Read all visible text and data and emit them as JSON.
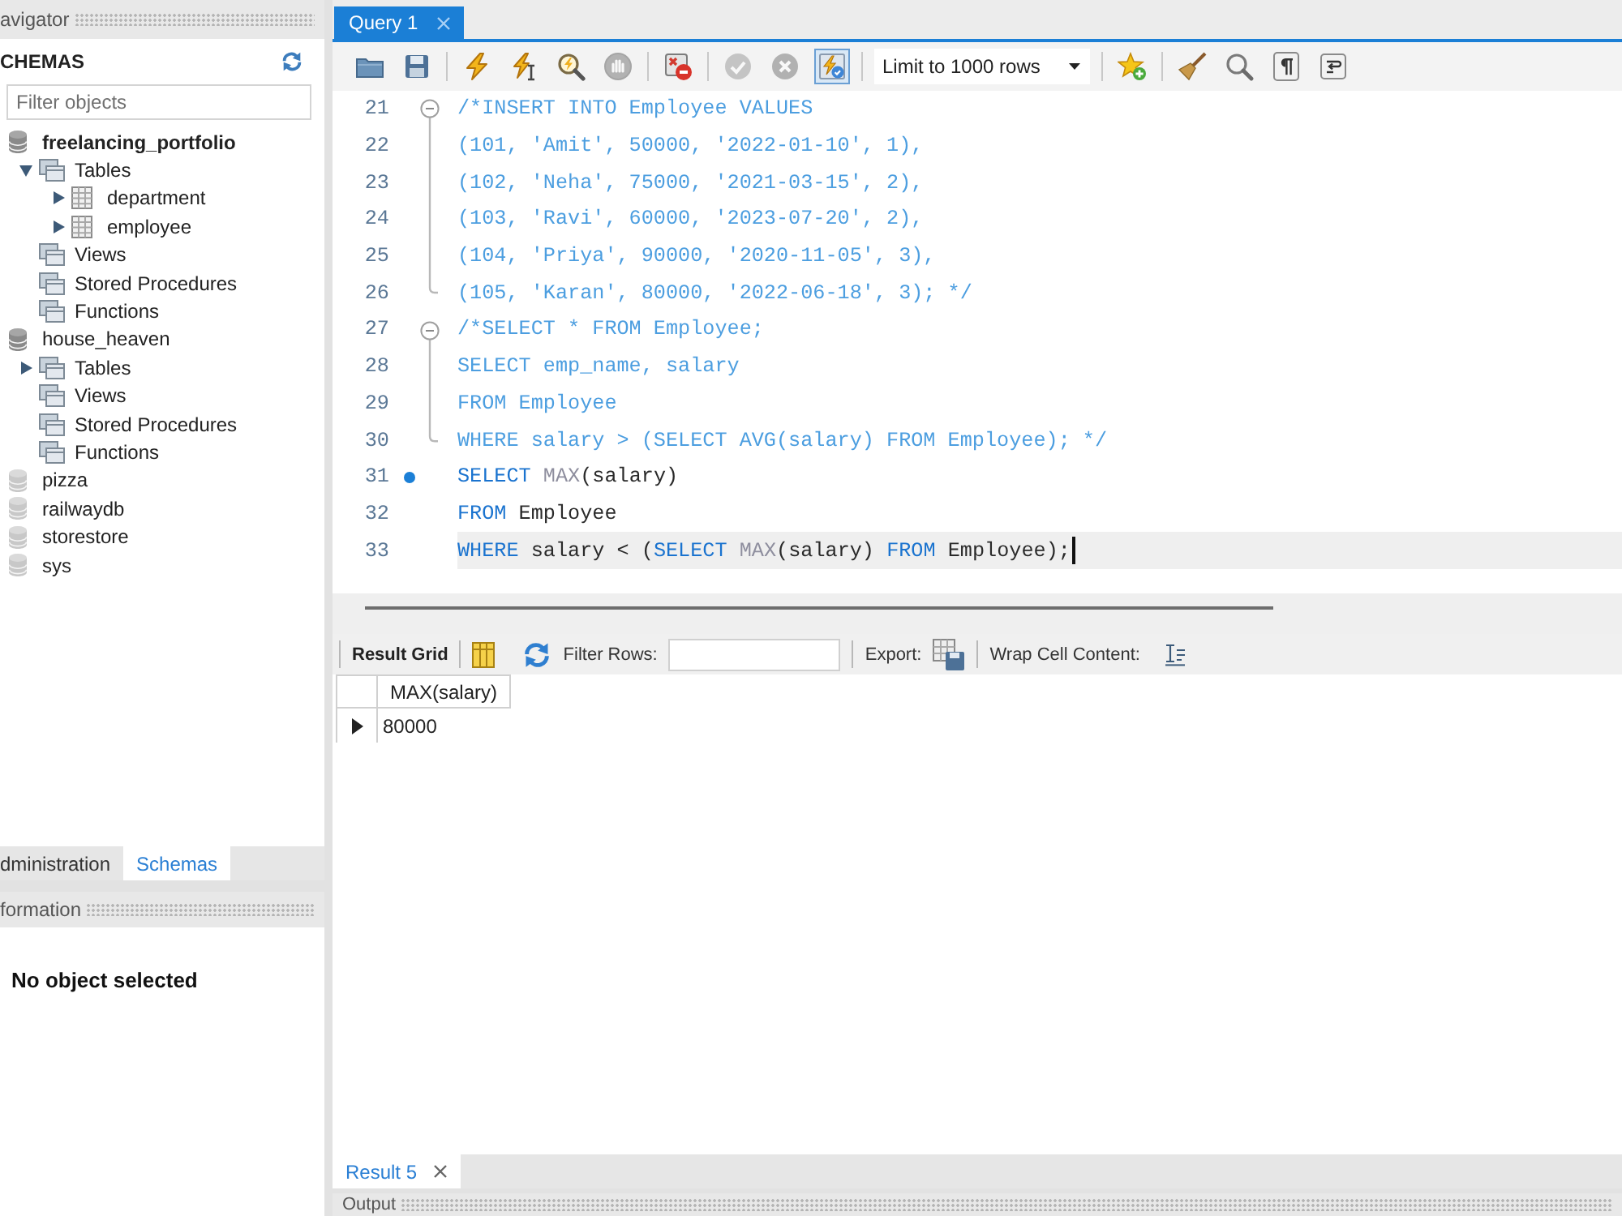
{
  "navigator": {
    "header": "avigator",
    "schemas_title": "CHEMAS",
    "filter": {
      "placeholder": "Filter objects"
    },
    "schemas": [
      {
        "kind": "schema",
        "name": "freelancing_portfolio",
        "default": true,
        "expanded": true,
        "children": [
          {
            "kind": "folder",
            "name": "Tables",
            "expanded": true,
            "children": [
              {
                "kind": "table",
                "name": "department",
                "expanded": false
              },
              {
                "kind": "table",
                "name": "employee",
                "expanded": false
              }
            ]
          },
          {
            "kind": "folder",
            "name": "Views"
          },
          {
            "kind": "folder",
            "name": "Stored Procedures"
          },
          {
            "kind": "folder",
            "name": "Functions"
          }
        ]
      },
      {
        "kind": "schema",
        "name": "house_heaven",
        "default": false,
        "expanded": true,
        "children": [
          {
            "kind": "folder",
            "name": "Tables",
            "expanded": false
          },
          {
            "kind": "folder",
            "name": "Views"
          },
          {
            "kind": "folder",
            "name": "Stored Procedures"
          },
          {
            "kind": "folder",
            "name": "Functions"
          }
        ]
      },
      {
        "kind": "schema",
        "name": "pizza",
        "default": false,
        "expanded": false
      },
      {
        "kind": "schema",
        "name": "railwaydb",
        "default": false,
        "expanded": false
      },
      {
        "kind": "schema",
        "name": "storestore",
        "default": false,
        "expanded": false
      },
      {
        "kind": "schema",
        "name": "sys",
        "default": false,
        "expanded": false
      }
    ],
    "tabs": [
      {
        "label": "dministration",
        "selected": false
      },
      {
        "label": "Schemas",
        "selected": true
      }
    ]
  },
  "information": {
    "header": "formation",
    "message": "No object selected"
  },
  "editor": {
    "tabs": [
      {
        "label": "Query 1",
        "selected": true
      }
    ],
    "toolbar": {
      "groups": [
        [
          {
            "kind": "open",
            "disabled": false,
            "pressed": false
          },
          {
            "kind": "save",
            "disabled": false,
            "pressed": false
          }
        ],
        [
          {
            "kind": "execute",
            "disabled": false,
            "pressed": false
          },
          {
            "kind": "execute-statement",
            "disabled": false,
            "pressed": false
          },
          {
            "kind": "explain",
            "disabled": false,
            "pressed": false
          },
          {
            "kind": "stop",
            "disabled": true,
            "pressed": false
          }
        ],
        [
          {
            "kind": "stop-on-error",
            "disabled": false,
            "pressed": false
          }
        ],
        [
          {
            "kind": "commit",
            "disabled": true,
            "pressed": false
          },
          {
            "kind": "rollback",
            "disabled": true,
            "pressed": false
          },
          {
            "kind": "autocommit",
            "disabled": false,
            "pressed": true
          }
        ],
        [
          {
            "kind": "dropdown",
            "value": "Limit to 1000 rows"
          }
        ],
        [
          {
            "kind": "bookmark",
            "disabled": false,
            "pressed": false
          }
        ],
        [
          {
            "kind": "beautify",
            "disabled": false,
            "pressed": false
          },
          {
            "kind": "find",
            "disabled": false,
            "pressed": false
          },
          {
            "kind": "invisibles",
            "disabled": false,
            "pressed": false
          },
          {
            "kind": "wrap",
            "disabled": false,
            "pressed": false
          }
        ]
      ]
    },
    "lines": [
      {
        "number": "21",
        "kind": "opener",
        "marker": false,
        "current": false,
        "tokens": [
          {
            "kind": "comment",
            "text": "/*INSERT INTO Employee VALUES"
          }
        ]
      },
      {
        "number": "22",
        "kind": "body",
        "marker": false,
        "current": false,
        "tokens": [
          {
            "kind": "comment",
            "text": "(101, 'Amit', 50000, '2022-01-10', 1),"
          }
        ]
      },
      {
        "number": "23",
        "kind": "body",
        "marker": false,
        "current": false,
        "tokens": [
          {
            "kind": "comment",
            "text": "(102, 'Neha', 75000, '2021-03-15', 2),"
          }
        ]
      },
      {
        "number": "24",
        "kind": "body",
        "marker": false,
        "current": false,
        "tokens": [
          {
            "kind": "comment",
            "text": "(103, 'Ravi', 60000, '2023-07-20', 2),"
          }
        ]
      },
      {
        "number": "25",
        "kind": "body",
        "marker": false,
        "current": false,
        "tokens": [
          {
            "kind": "comment",
            "text": "(104, 'Priya', 90000, '2020-11-05', 3),"
          }
        ]
      },
      {
        "number": "26",
        "kind": "closer",
        "marker": false,
        "current": false,
        "tokens": [
          {
            "kind": "comment",
            "text": "(105, 'Karan', 80000, '2022-06-18', 3); */"
          }
        ]
      },
      {
        "number": "27",
        "kind": "opener",
        "marker": false,
        "current": false,
        "tokens": [
          {
            "kind": "comment",
            "text": "/*SELECT * FROM Employee;"
          }
        ]
      },
      {
        "number": "28",
        "kind": "body",
        "marker": false,
        "current": false,
        "tokens": [
          {
            "kind": "comment",
            "text": "SELECT emp_name, salary"
          }
        ]
      },
      {
        "number": "29",
        "kind": "body",
        "marker": false,
        "current": false,
        "tokens": [
          {
            "kind": "comment",
            "text": "FROM Employee"
          }
        ]
      },
      {
        "number": "30",
        "kind": "closer",
        "marker": false,
        "current": false,
        "tokens": [
          {
            "kind": "comment",
            "text": "WHERE salary > (SELECT AVG(salary) FROM Employee); */"
          }
        ]
      },
      {
        "number": "31",
        "kind": "plain",
        "marker": true,
        "current": false,
        "tokens": [
          {
            "kind": "keyword",
            "text": "SELECT "
          },
          {
            "kind": "function",
            "text": "MAX"
          },
          {
            "kind": "plain",
            "text": "(salary)"
          }
        ]
      },
      {
        "number": "32",
        "kind": "plain",
        "marker": false,
        "current": false,
        "tokens": [
          {
            "kind": "keyword",
            "text": "FROM"
          },
          {
            "kind": "plain",
            "text": " Employee"
          }
        ]
      },
      {
        "number": "33",
        "kind": "plain",
        "marker": false,
        "current": true,
        "tokens": [
          {
            "kind": "keyword",
            "text": "WHERE"
          },
          {
            "kind": "plain",
            "text": " salary < ("
          },
          {
            "kind": "keyword",
            "text": "SELECT "
          },
          {
            "kind": "function",
            "text": "MAX"
          },
          {
            "kind": "plain",
            "text": "(salary) "
          },
          {
            "kind": "keyword",
            "text": "FROM"
          },
          {
            "kind": "plain",
            "text": " Employee);"
          }
        ]
      }
    ]
  },
  "results": {
    "toolbar": {
      "view_label": "Result Grid",
      "filter_label": "Filter Rows:",
      "export_label": "Export:",
      "wrap_label": "Wrap Cell Content:"
    },
    "grid": {
      "columns": [
        "MAX(salary)"
      ],
      "rows": [
        {
          "current": true,
          "cells": [
            "80000"
          ]
        }
      ]
    },
    "tabs": [
      {
        "label": "Result 5",
        "selected": true
      }
    ]
  },
  "output": {
    "header": "Output"
  }
}
